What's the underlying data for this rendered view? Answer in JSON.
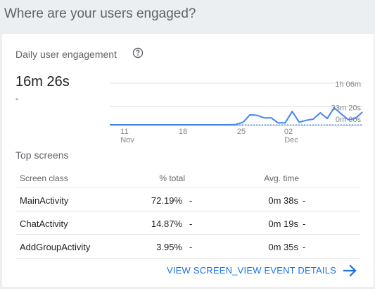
{
  "page_title": "Where are your users engaged?",
  "card": {
    "title": "Daily user engagement",
    "metric_value": "16m 26s",
    "metric_delta": "-",
    "chart_data": {
      "type": "line",
      "y_ticks": [
        "1h 06m",
        "33m 20s",
        "0m 00s"
      ],
      "x_ticks": [
        {
          "day": "11",
          "month": "Nov"
        },
        {
          "day": "18",
          "month": ""
        },
        {
          "day": "25",
          "month": ""
        },
        {
          "day": "02",
          "month": "Dec"
        }
      ],
      "ylim": [
        0,
        66
      ],
      "series": [
        {
          "values": [
            0,
            0,
            0,
            0,
            0,
            0,
            0,
            0,
            0,
            0,
            0,
            0,
            0,
            0,
            0,
            0,
            0,
            0,
            0.5,
            4,
            16,
            15,
            11,
            11,
            3,
            3,
            21,
            4,
            7,
            9,
            19,
            10,
            27,
            17,
            8,
            10,
            20
          ]
        }
      ],
      "line_color": "#4285f4"
    },
    "top_screens": {
      "title": "Top screens",
      "columns": [
        "Screen class",
        "% total",
        "Avg. time"
      ],
      "rows": [
        {
          "name": "MainActivity",
          "pct": "72.19%",
          "pct_delta": "-",
          "avg": "0m 38s",
          "avg_delta": "-"
        },
        {
          "name": "ChatActivity",
          "pct": "14.87%",
          "pct_delta": "-",
          "avg": "0m 19s",
          "avg_delta": "-"
        },
        {
          "name": "AddGroupActivity",
          "pct": "3.95%",
          "pct_delta": "-",
          "avg": "0m 35s",
          "avg_delta": "-"
        }
      ]
    },
    "link_label": "VIEW SCREEN_VIEW EVENT DETAILS",
    "accent_color": "#1a73e8"
  }
}
